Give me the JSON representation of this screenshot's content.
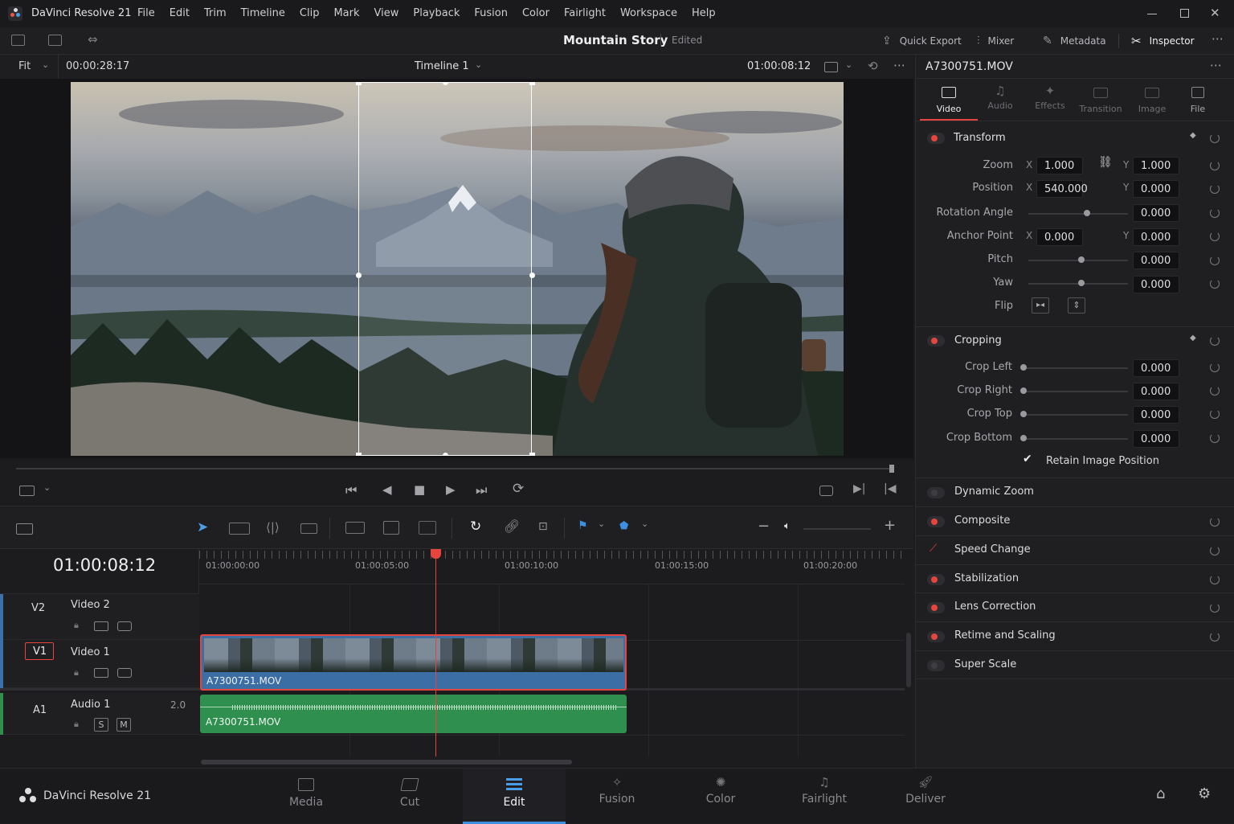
{
  "app": {
    "name": "DaVinci Resolve 21"
  },
  "menu": [
    "File",
    "Edit",
    "Trim",
    "Timeline",
    "Clip",
    "Mark",
    "View",
    "Playback",
    "Fusion",
    "Color",
    "Fairlight",
    "Workspace",
    "Help"
  ],
  "project": {
    "title": "Mountain Story",
    "status": "Edited"
  },
  "toolbar": {
    "quick_export": "Quick Export",
    "mixer": "Mixer",
    "metadata": "Metadata",
    "inspector": "Inspector"
  },
  "viewer": {
    "fit": "Fit",
    "source_tc": "00:00:28:17",
    "timeline_name": "Timeline 1",
    "record_tc": "01:00:08:12"
  },
  "inspector": {
    "clip_name": "A7300751.MOV",
    "tabs": [
      "Video",
      "Audio",
      "Effects",
      "Transition",
      "Image",
      "File"
    ],
    "active_tab": "Video",
    "transform": {
      "title": "Transform",
      "zoom_label": "Zoom",
      "zoom_x": "1.000",
      "zoom_y": "1.000",
      "position_label": "Position",
      "position_x": "540.000",
      "position_y": "0.000",
      "rotation_label": "Rotation Angle",
      "rotation": "0.000",
      "anchor_label": "Anchor Point",
      "anchor_x": "0.000",
      "anchor_y": "0.000",
      "pitch_label": "Pitch",
      "pitch": "0.000",
      "yaw_label": "Yaw",
      "yaw": "0.000",
      "flip_label": "Flip",
      "x": "X",
      "y": "Y"
    },
    "cropping": {
      "title": "Cropping",
      "left_label": "Crop Left",
      "left": "0.000",
      "right_label": "Crop Right",
      "right": "0.000",
      "top_label": "Crop Top",
      "top": "0.000",
      "bottom_label": "Crop Bottom",
      "bottom": "0.000",
      "retain": "Retain Image Position"
    },
    "sections": [
      "Dynamic Zoom",
      "Composite",
      "Speed Change",
      "Stabilization",
      "Lens Correction",
      "Retime and Scaling",
      "Super Scale"
    ]
  },
  "timeline": {
    "current_tc": "01:00:08:12",
    "ruler": [
      "01:00:00:00",
      "01:00:05:00",
      "01:00:10:00",
      "01:00:15:00",
      "01:00:20:00"
    ],
    "tracks": [
      {
        "id": "V2",
        "name": "Video 2"
      },
      {
        "id": "V1",
        "name": "Video 1"
      },
      {
        "id": "A1",
        "name": "Audio 1",
        "channels": "2.0"
      }
    ],
    "video_clip": "A7300751.MOV",
    "audio_clip": "A7300751.MOV",
    "solo": "S",
    "mute": "M"
  },
  "pages": [
    "Media",
    "Cut",
    "Edit",
    "Fusion",
    "Color",
    "Fairlight",
    "Deliver"
  ],
  "active_page": "Edit",
  "colors": {
    "accent": "#3d8fe0",
    "playhead": "#e5453d",
    "video_clip": "#3a6ea5",
    "audio_clip": "#2f8f4e"
  }
}
